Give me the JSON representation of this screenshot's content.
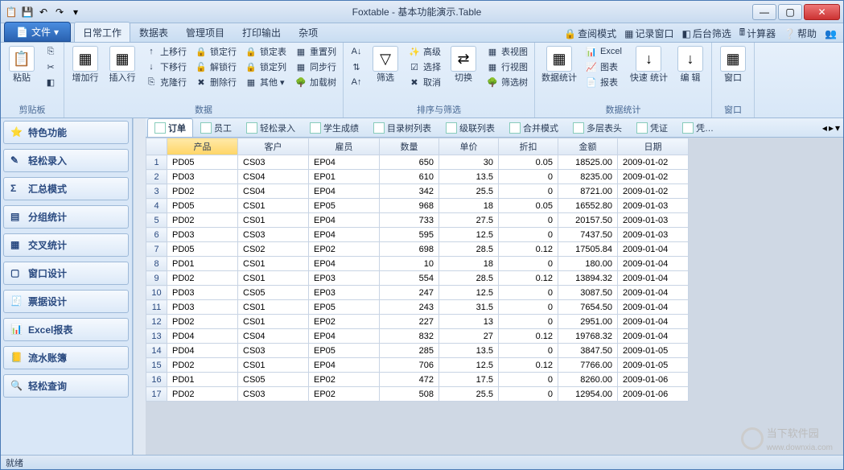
{
  "window": {
    "app": "Foxtable",
    "title": "Foxtable - 基本功能演示.Table"
  },
  "qat": [
    "app-icon",
    "save",
    "undo",
    "redo"
  ],
  "file_menu": {
    "label": "文件"
  },
  "ribbon_tabs": [
    "日常工作",
    "数据表",
    "管理项目",
    "打印输出",
    "杂项"
  ],
  "ribbon_right": [
    {
      "icon": "lock",
      "label": "查阅模式"
    },
    {
      "icon": "grid",
      "label": "记录窗口"
    },
    {
      "icon": "filter",
      "label": "后台筛选"
    },
    {
      "icon": "calc",
      "label": "计算器"
    },
    {
      "icon": "help",
      "label": "帮助"
    },
    {
      "icon": "people",
      "label": ""
    }
  ],
  "ribbon_groups": {
    "clipboard": {
      "label": "剪贴板",
      "paste": "粘贴"
    },
    "rows": {
      "add": "增加行",
      "insert": "插入行"
    },
    "data": {
      "label": "数据",
      "col1": [
        "上移行",
        "下移行",
        "克隆行"
      ],
      "col2": [
        "锁定行",
        "解锁行",
        "删除行"
      ],
      "col3": [
        "锁定表",
        "锁定列",
        "其他"
      ],
      "col4": [
        "重置列",
        "同步行",
        "加载树"
      ]
    },
    "sort": {
      "label": "排序与筛选",
      "filter": "筛选",
      "col1": [
        "高级",
        "选择",
        "取消"
      ],
      "switch": "切换",
      "col2": [
        "表视图",
        "行视图",
        "筛选树"
      ]
    },
    "stats": {
      "label": "数据统计",
      "main": "数据统计",
      "col": [
        "Excel",
        "图表",
        "报表"
      ],
      "fast": "快速\n统计",
      "edit": "编\n辑"
    },
    "window": {
      "label": "窗口",
      "btn": "窗口"
    }
  },
  "sidebar": [
    "特色功能",
    "轻松录入",
    "汇总模式",
    "分组统计",
    "交叉统计",
    "窗口设计",
    "票据设计",
    "Excel报表",
    "流水账簿",
    "轻松查询"
  ],
  "table_tabs": [
    "订单",
    "员工",
    "轻松录入",
    "学生成绩",
    "目录树列表",
    "级联列表",
    "合并模式",
    "多层表头",
    "凭证",
    "凭…"
  ],
  "columns": [
    "产品",
    "客户",
    "雇员",
    "数量",
    "单价",
    "折扣",
    "金额",
    "日期"
  ],
  "rows": [
    [
      "PD05",
      "CS03",
      "EP04",
      "650",
      "30",
      "0.05",
      "18525.00",
      "2009-01-02"
    ],
    [
      "PD03",
      "CS04",
      "EP01",
      "610",
      "13.5",
      "0",
      "8235.00",
      "2009-01-02"
    ],
    [
      "PD02",
      "CS04",
      "EP04",
      "342",
      "25.5",
      "0",
      "8721.00",
      "2009-01-02"
    ],
    [
      "PD05",
      "CS01",
      "EP05",
      "968",
      "18",
      "0.05",
      "16552.80",
      "2009-01-03"
    ],
    [
      "PD02",
      "CS01",
      "EP04",
      "733",
      "27.5",
      "0",
      "20157.50",
      "2009-01-03"
    ],
    [
      "PD03",
      "CS03",
      "EP04",
      "595",
      "12.5",
      "0",
      "7437.50",
      "2009-01-03"
    ],
    [
      "PD05",
      "CS02",
      "EP02",
      "698",
      "28.5",
      "0.12",
      "17505.84",
      "2009-01-04"
    ],
    [
      "PD01",
      "CS01",
      "EP04",
      "10",
      "18",
      "0",
      "180.00",
      "2009-01-04"
    ],
    [
      "PD02",
      "CS01",
      "EP03",
      "554",
      "28.5",
      "0.12",
      "13894.32",
      "2009-01-04"
    ],
    [
      "PD03",
      "CS05",
      "EP03",
      "247",
      "12.5",
      "0",
      "3087.50",
      "2009-01-04"
    ],
    [
      "PD03",
      "CS01",
      "EP05",
      "243",
      "31.5",
      "0",
      "7654.50",
      "2009-01-04"
    ],
    [
      "PD02",
      "CS01",
      "EP02",
      "227",
      "13",
      "0",
      "2951.00",
      "2009-01-04"
    ],
    [
      "PD04",
      "CS04",
      "EP04",
      "832",
      "27",
      "0.12",
      "19768.32",
      "2009-01-04"
    ],
    [
      "PD04",
      "CS03",
      "EP05",
      "285",
      "13.5",
      "0",
      "3847.50",
      "2009-01-05"
    ],
    [
      "PD02",
      "CS01",
      "EP04",
      "706",
      "12.5",
      "0.12",
      "7766.00",
      "2009-01-05"
    ],
    [
      "PD01",
      "CS05",
      "EP02",
      "472",
      "17.5",
      "0",
      "8260.00",
      "2009-01-06"
    ],
    [
      "PD02",
      "CS03",
      "EP02",
      "508",
      "25.5",
      "0",
      "12954.00",
      "2009-01-06"
    ]
  ],
  "status": "就绪",
  "watermark": {
    "name": "当下软件园",
    "url": "www.downxia.com"
  }
}
